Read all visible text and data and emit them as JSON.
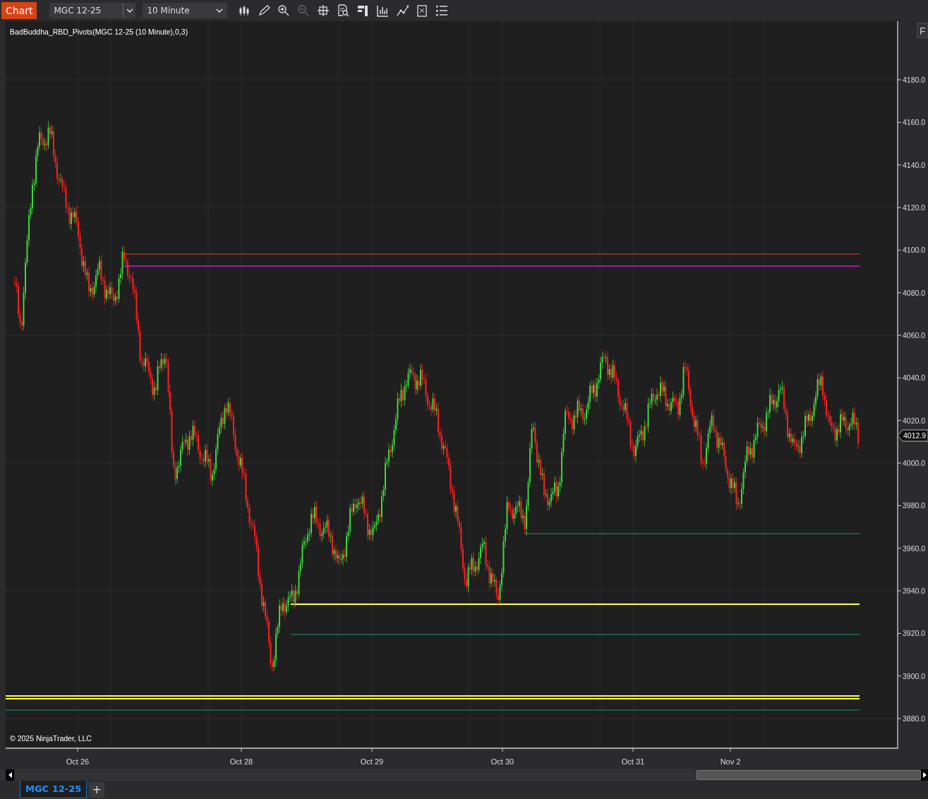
{
  "window": {
    "title": "Chart"
  },
  "toolbar": {
    "instrument": "MGC 12-25",
    "interval": "10 Minute"
  },
  "indicator_label": "BadBuddha_RBD_Pivots(MGC 12-25 (10 Minute),0,3)",
  "corner_button": "F",
  "price_axis": {
    "labels": [
      "4180.0",
      "4160.0",
      "4140.0",
      "4120.0",
      "4100.0",
      "4080.0",
      "4060.0",
      "4040.0",
      "4020.0",
      "4000.0",
      "3980.0",
      "3960.0",
      "3940.0",
      "3920.0",
      "3900.0",
      "3880.0"
    ],
    "last_price": "4012.9"
  },
  "time_axis": {
    "labels": [
      "Oct 26",
      "Oct 28",
      "Oct 29",
      "Oct 30",
      "Oct 31",
      "Nov 2"
    ]
  },
  "copyright": "© 2025 NinjaTrader, LLC",
  "tabs": [
    {
      "label": "MGC 12-25",
      "selected": true
    }
  ],
  "add_tab": "+"
}
